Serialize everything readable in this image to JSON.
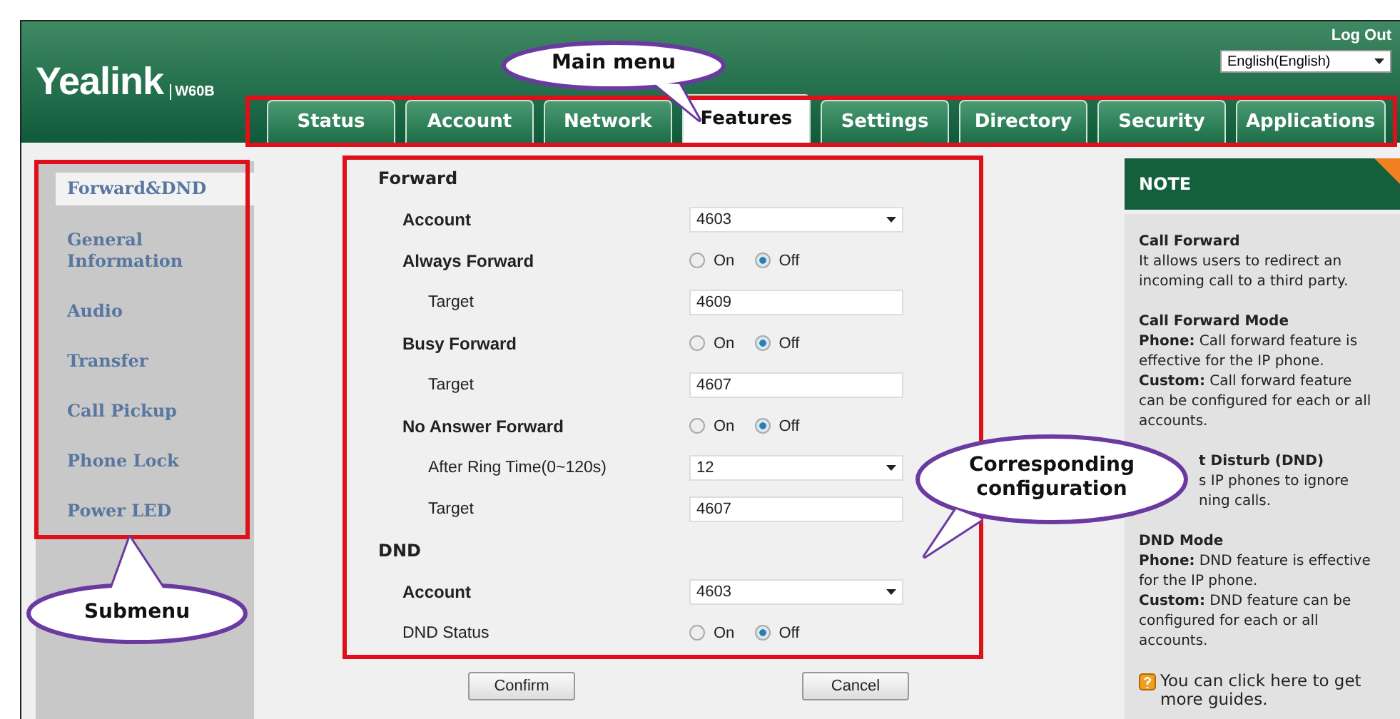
{
  "header": {
    "logo": {
      "brand": "Yealink",
      "model": "W60B"
    },
    "logout": "Log Out",
    "language": "English(English)"
  },
  "tabs": [
    {
      "label": "Status",
      "selected": false
    },
    {
      "label": "Account",
      "selected": false
    },
    {
      "label": "Network",
      "selected": false
    },
    {
      "label": "Features",
      "selected": true
    },
    {
      "label": "Settings",
      "selected": false
    },
    {
      "label": "Directory",
      "selected": false
    },
    {
      "label": "Security",
      "selected": false
    },
    {
      "label": "Applications",
      "selected": false
    }
  ],
  "sidebar": {
    "items": [
      {
        "label": "Forward&DND",
        "selected": true
      },
      {
        "label": "General Information",
        "selected": false
      },
      {
        "label": "Audio",
        "selected": false
      },
      {
        "label": "Transfer",
        "selected": false
      },
      {
        "label": "Call Pickup",
        "selected": false
      },
      {
        "label": "Phone Lock",
        "selected": false
      },
      {
        "label": "Power LED",
        "selected": false
      }
    ]
  },
  "form": {
    "sections": [
      {
        "title": "Forward",
        "rows": [
          {
            "kind": "select",
            "label": "Account",
            "bold": true,
            "value": "4603"
          },
          {
            "kind": "radio",
            "label": "Always Forward",
            "bold": true,
            "options": [
              {
                "label": "On",
                "selected": false
              },
              {
                "label": "Off",
                "selected": true
              }
            ],
            "children": [
              {
                "kind": "text",
                "label": "Target",
                "bold": false,
                "value": "4609"
              }
            ]
          },
          {
            "kind": "radio",
            "label": "Busy Forward",
            "bold": true,
            "options": [
              {
                "label": "On",
                "selected": false
              },
              {
                "label": "Off",
                "selected": true
              }
            ],
            "children": [
              {
                "kind": "text",
                "label": "Target",
                "bold": false,
                "value": "4607"
              }
            ]
          },
          {
            "kind": "radio",
            "label": "No Answer Forward",
            "bold": true,
            "options": [
              {
                "label": "On",
                "selected": false
              },
              {
                "label": "Off",
                "selected": true
              }
            ],
            "children": [
              {
                "kind": "select",
                "label": "After Ring Time(0~120s)",
                "bold": false,
                "value": "12"
              },
              {
                "kind": "text",
                "label": "Target",
                "bold": false,
                "value": "4607"
              }
            ]
          }
        ]
      },
      {
        "title": "DND",
        "rows": [
          {
            "kind": "select",
            "label": "Account",
            "bold": true,
            "value": "4603"
          },
          {
            "kind": "radio",
            "label": "DND Status",
            "bold": false,
            "options": [
              {
                "label": "On",
                "selected": false
              },
              {
                "label": "Off",
                "selected": true
              }
            ]
          }
        ]
      }
    ],
    "buttons": [
      "Confirm",
      "Cancel"
    ]
  },
  "note": {
    "title": "NOTE",
    "paragraphs": [
      {
        "kind": "full",
        "title": "Call Forward",
        "lines": [
          "It allows users to redirect an incoming call to a third party."
        ]
      },
      {
        "kind": "full",
        "title": "Call Forward Mode",
        "lines": [
          "**Phone:** Call forward feature is effective for the IP phone.",
          "**Custom:** Call forward feature can be configured for each or all accounts."
        ]
      },
      {
        "kind": "covered",
        "title": "t Disturb (DND)",
        "lines": [
          "s IP phones to ignore",
          "ning calls."
        ]
      },
      {
        "kind": "full",
        "title": "DND Mode",
        "lines": [
          "**Phone:** DND feature is effective for the IP phone.",
          "**Custom:** DND feature can be configured for each or all accounts."
        ]
      }
    ],
    "help": "You can click here to get more guides."
  },
  "annotations": [
    {
      "kind": "main",
      "text": "Main menu"
    },
    {
      "kind": "sub",
      "text": "Submenu"
    },
    {
      "kind": "config",
      "text": "Corresponding configuration"
    }
  ]
}
